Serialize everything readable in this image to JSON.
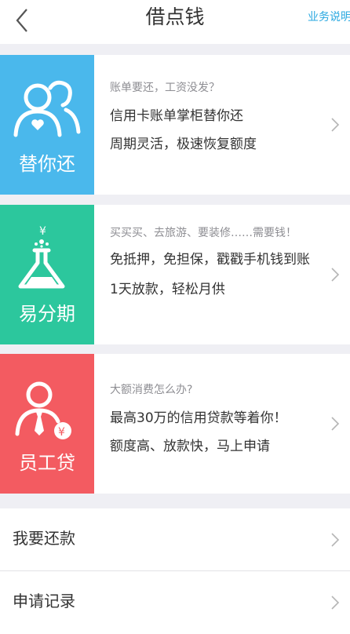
{
  "header": {
    "title": "借点钱",
    "help_link": "业务说明"
  },
  "cards": [
    {
      "tile_label": "替你还",
      "tile_color": "#4ab8ec",
      "icon": "user-with-heart-icon",
      "subtitle": "账单要还，工资没发？",
      "line1": "信用卡账单掌柜替你还",
      "line2": "周期灵活，极速恢复额度"
    },
    {
      "tile_label": "易分期",
      "tile_color": "#2cc79d",
      "icon": "flask-yen-icon",
      "subtitle": "买买买、去旅游、要装修……需要钱！",
      "line1": "免抵押，免担保，戳戳手机钱到账",
      "line2": "1天放款，轻松月供"
    },
    {
      "tile_label": "员工贷",
      "tile_color": "#f35b61",
      "icon": "employee-yen-icon",
      "subtitle": "大额消费怎么办?",
      "line1": "最高30万的信用贷款等着你！",
      "line2": "额度高、放款快，马上申请"
    }
  ],
  "list": [
    {
      "label": "我要还款"
    },
    {
      "label": "申请记录"
    }
  ]
}
